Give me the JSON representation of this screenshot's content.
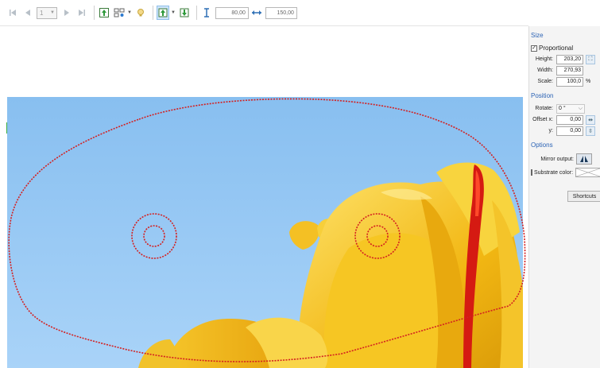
{
  "toolbar": {
    "page_value": "1",
    "height_value": "80,00",
    "width_value": "150,00"
  },
  "panel": {
    "size": {
      "title": "Size",
      "proportional_label": "Proportional",
      "proportional_checked": true,
      "height_label": "Height:",
      "height_value": "203,20",
      "width_label": "Width:",
      "width_value": "270,93",
      "scale_label": "Scale:",
      "scale_value": "100,0",
      "scale_unit": "%"
    },
    "position": {
      "title": "Position",
      "rotate_label": "Rotate:",
      "rotate_value": "0 °",
      "offset_x_label": "Offset x:",
      "offset_x_value": "0,00",
      "offset_y_label": "y:",
      "offset_y_value": "0,00"
    },
    "options": {
      "title": "Options",
      "mirror_label": "Mirror output:",
      "substrate_label": "Substrate color:",
      "substrate_checked": false
    },
    "shortcuts_label": "Shortcuts"
  },
  "colors": {
    "accent": "#2b63b5",
    "sky": "#8ec3f0",
    "petal": "#f2c21a",
    "cut_line": "#d42020"
  }
}
